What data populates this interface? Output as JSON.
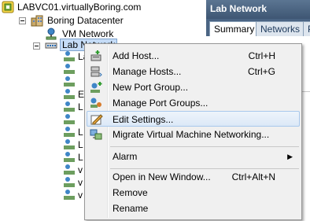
{
  "tree": {
    "vcenter": {
      "label": "LABVC01.virtuallyBoring.com",
      "icon": "vcenter-server-icon"
    },
    "datacenter": {
      "label": "Boring Datacenter",
      "icon": "datacenter-icon"
    },
    "vm_network": {
      "label": "VM Network",
      "icon": "network-icon"
    },
    "lab_network": {
      "label": "Lab Network",
      "icon": "distributed-switch-icon"
    },
    "children": [
      "La",
      "",
      "",
      "E",
      "L",
      "",
      "L",
      "L",
      "L",
      "v",
      "v",
      "v"
    ]
  },
  "panel": {
    "title": "Lab Network",
    "tabs": [
      {
        "label": "Summary",
        "active": true
      },
      {
        "label": "Networks",
        "active": false
      },
      {
        "label": "P",
        "active": false
      }
    ]
  },
  "context_menu": {
    "items": [
      {
        "label": "Add Host...",
        "shortcut": "Ctrl+H",
        "icon": "add-host-icon"
      },
      {
        "label": "Manage Hosts...",
        "shortcut": "Ctrl+G",
        "icon": "manage-hosts-icon"
      },
      {
        "label": "New Port Group...",
        "shortcut": "",
        "icon": "new-port-group-icon"
      },
      {
        "label": "Manage Port Groups...",
        "shortcut": "",
        "icon": "manage-port-groups-icon"
      },
      {
        "label": "Edit Settings...",
        "shortcut": "",
        "icon": "edit-settings-icon",
        "highlighted": true
      },
      {
        "label": "Migrate Virtual Machine Networking...",
        "shortcut": "",
        "icon": "migrate-networking-icon"
      },
      {
        "label": "Alarm",
        "shortcut": "",
        "submenu": true
      },
      {
        "label": "Open in New Window...",
        "shortcut": "Ctrl+Alt+N"
      },
      {
        "label": "Remove",
        "shortcut": ""
      },
      {
        "label": "Rename",
        "shortcut": ""
      }
    ],
    "highlight_color": "#dbe8f7"
  },
  "colors": {
    "panel_header": "#3e5673",
    "selection": "#c5dcf7"
  }
}
